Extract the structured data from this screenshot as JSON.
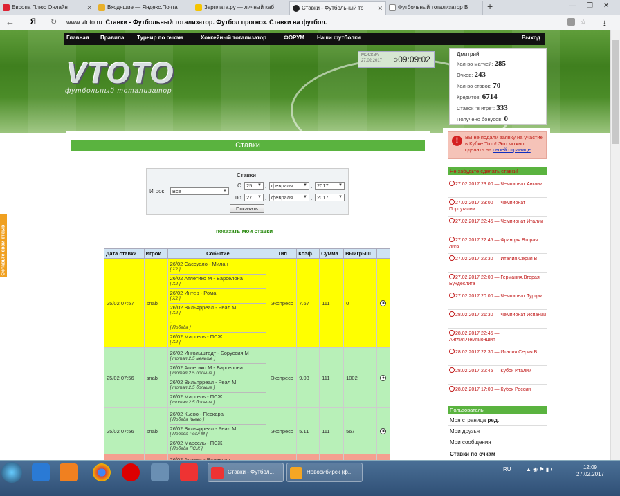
{
  "browser": {
    "tabs": [
      {
        "label": "Европа Плюс Онлайн"
      },
      {
        "label": "Входящие — Яндекс.Почта"
      },
      {
        "label": "Зарплата.ру — личный каб"
      },
      {
        "label": "Ставки - Футбольный то"
      },
      {
        "label": "Футбольный тотализатор В"
      }
    ],
    "new_tab": "+",
    "address_url_domain": "www.vtoto.ru",
    "address_url_title": "Ставки - Футбольный тотализатор. Футбол прогноз. Ставки на футбол.",
    "yandex": "Я"
  },
  "nav": {
    "items": [
      "Главная",
      "Правила",
      "Турнир по очкам",
      "Хоккейный тотализатор",
      "ФОРУМ",
      "Наши футболки"
    ],
    "logout": "Выход"
  },
  "logo": {
    "text": "VTOTO",
    "subtitle": "футбольный тотализатор"
  },
  "clock": {
    "city": "МОСКВА",
    "date": "27.02.2017",
    "time": "09:09:02"
  },
  "user": {
    "name": "Дмитрий",
    "stats": [
      {
        "label": "Кол-во матчей:",
        "value": "285"
      },
      {
        "label": "Очков:",
        "value": "243"
      },
      {
        "label": "Кол-во ставок:",
        "value": "70"
      },
      {
        "label": "Кредитов:",
        "value": "6714"
      },
      {
        "label": "Ставок \"в игре\":",
        "value": "333"
      },
      {
        "label": "Получено бонусов:",
        "value": "0"
      }
    ]
  },
  "feedback_tab": "Оставьте свой отзыв",
  "page_title": "Ставки",
  "filter": {
    "caption": "Ставки",
    "player_label": "Игрок",
    "player_value": "Все",
    "from_label": "С",
    "to_label": "по",
    "from_day": "25",
    "from_month": "февраля",
    "from_year": "2017",
    "to_day": "27",
    "to_month": "февраля",
    "to_year": "2017",
    "dot": ".",
    "submit": "Показать"
  },
  "show_my_bets": "показать мои ставки",
  "table": {
    "headers": [
      "Дата ставки",
      "Игрок",
      "Событие",
      "Тип",
      "Коэф.",
      "Сумма",
      "Выигрыш"
    ],
    "rows": [
      {
        "date": "25/02 07:57",
        "player": "snab",
        "type": "Экспресс",
        "coef": "7.67",
        "sum": "111",
        "win": "0",
        "events": [
          {
            "match": "26/02 Сассуоло - Милан",
            "pick": "[ Х2 ]"
          },
          {
            "match": "26/02 Атлетико М - Барселона",
            "pick": "[ Х2 ]"
          },
          {
            "match": "26/02 Интер - Рома",
            "pick": "[ Х2 ]"
          },
          {
            "match": "26/02 Вильярреал - Реал М",
            "pick": "[ Х2 ]"
          },
          {
            "match": "-",
            "pick": "[ Победа ]"
          },
          {
            "match": "26/02 Марсель - ПСЖ",
            "pick": "[ Х2 ]"
          }
        ]
      },
      {
        "date": "25/02 07:56",
        "player": "snab",
        "type": "Экспресс",
        "coef": "9.03",
        "sum": "111",
        "win": "1002",
        "events": [
          {
            "match": "26/02 Ингольштадт - Боруссия М",
            "pick": "[ тотал 2.5 меньше ]"
          },
          {
            "match": "26/02 Атлетико М - Барселона",
            "pick": "[ тотал 2.5 больше ]"
          },
          {
            "match": "26/02 Вильярреал - Реал М",
            "pick": "[ тотал 2.5 больше ]"
          },
          {
            "match": "26/02 Марсель - ПСЖ",
            "pick": "[ тотал 2.5 больше ]"
          }
        ]
      },
      {
        "date": "25/02 07:56",
        "player": "snab",
        "type": "Экспресс",
        "coef": "5.11",
        "sum": "111",
        "win": "567",
        "events": [
          {
            "match": "26/02 Кьево - Пескара",
            "pick": "[ Победа Кьево ]"
          },
          {
            "match": "26/02 Вильярреал - Реал М",
            "pick": "[ Победа Реал М ]"
          },
          {
            "match": "26/02 Марсель - ПСЖ",
            "pick": "[ Победа ПСЖ ]"
          }
        ]
      },
      {
        "date": "",
        "player": "",
        "type": "",
        "coef": "",
        "sum": "",
        "win": "",
        "events": [
          {
            "match": "26/02 Аланес - Валенсия",
            "pick": ""
          }
        ]
      }
    ]
  },
  "warning": {
    "text": "Вы не подали заявку на участие в Кубке Тото! Это можно сделать на ",
    "link": "своей странице",
    "end": "."
  },
  "reminder": {
    "title": "Не забудьте сделать ставки!",
    "items": [
      "27.02.2017 23:00 — Чемпионат Англии",
      "27.02.2017 23:00 — Чемпионат Португалии",
      "27.02.2017 22:45 — Чемпионат Италии",
      "27.02.2017 22:45 — Франция.Вторая лига",
      "27.02.2017 22:30 — Италия.Серия В",
      "27.02.2017 22:00 — Германия.Вторая Бундеслига",
      "27.02.2017 20:00 — Чемпионат Турции",
      "28.02.2017 21:30 — Чемпионат Испании",
      "28.02.2017 22:45 — Англия.Чемпионшип",
      "28.02.2017 22:30 — Италия.Серия В",
      "28.02.2017 22:45 — Кубок Италии",
      "28.02.2017 17:00 — Кубок России"
    ]
  },
  "user_menu": {
    "title": "Пользователь",
    "items": [
      "Моя страница",
      "Мои друзья",
      "Мои сообщения",
      "Ставки по очкам"
    ],
    "edit": "ред."
  },
  "taskbar": {
    "tasks": [
      "Ставки - Футбол...",
      "Новосибирск (ф..."
    ],
    "lang": "RU",
    "time": "12:09",
    "date": "27.02.2017"
  }
}
